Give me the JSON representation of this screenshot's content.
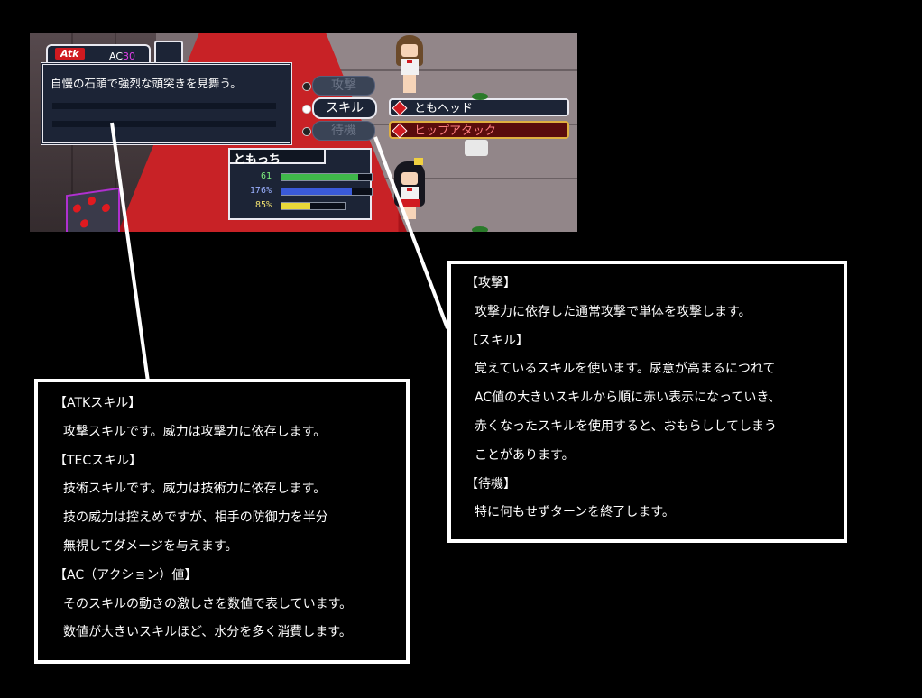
{
  "hud": {
    "atk_label": "Atk",
    "ac_prefix": "AC",
    "ac_value": "30",
    "description": "自慢の石頭で強烈な頭突きを見舞う。"
  },
  "commands": [
    {
      "label": "攻撃",
      "state": "dim"
    },
    {
      "label": "スキル",
      "state": "selected"
    },
    {
      "label": "待機",
      "state": "dim"
    }
  ],
  "skills": [
    {
      "label": "ともヘッド",
      "state": "selected"
    },
    {
      "label": "ヒップアタック",
      "state": "warning"
    }
  ],
  "status": {
    "name": "ともっち",
    "hp": {
      "value": "61",
      "fill": 0.85,
      "color": "#3fb84a"
    },
    "tec": {
      "value": "176%",
      "fill": 0.78,
      "color": "#3a5ad8"
    },
    "bladder": {
      "value": "85%",
      "fill": 0.45,
      "color": "#e8d838"
    }
  },
  "left_callout": {
    "lines": [
      {
        "text": "【ATKスキル】",
        "indent": false
      },
      {
        "text": "攻撃スキルです。威力は攻撃力に依存します。",
        "indent": true
      },
      {
        "text": "【TECスキル】",
        "indent": false
      },
      {
        "text": "技術スキルです。威力は技術力に依存します。",
        "indent": true
      },
      {
        "text": "技の威力は控えめですが、相手の防御力を半分",
        "indent": true
      },
      {
        "text": "無視してダメージを与えます。",
        "indent": true
      },
      {
        "text": "【AC（アクション）値】",
        "indent": false
      },
      {
        "text": "そのスキルの動きの激しさを数値で表しています。",
        "indent": true
      },
      {
        "text": "数値が大きいスキルほど、水分を多く消費します。",
        "indent": true
      }
    ]
  },
  "right_callout": {
    "lines": [
      {
        "text": "【攻撃】",
        "indent": false
      },
      {
        "text": "攻撃力に依存した通常攻撃で単体を攻撃します。",
        "indent": true
      },
      {
        "text": "【スキル】",
        "indent": false
      },
      {
        "text": "覚えているスキルを使います。尿意が高まるにつれて",
        "indent": true
      },
      {
        "text": "AC値の大きいスキルから順に赤い表示になっていき、",
        "indent": true
      },
      {
        "text": "赤くなったスキルを使用すると、おもらししてしまう",
        "indent": true
      },
      {
        "text": "ことがあります。",
        "indent": true
      },
      {
        "text": "【待機】",
        "indent": false
      },
      {
        "text": "特に何もせずターンを終了します。",
        "indent": true
      }
    ]
  }
}
